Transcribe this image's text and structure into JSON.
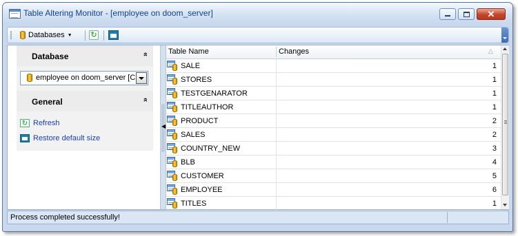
{
  "window": {
    "title": "Table Altering Monitor - [employee on doom_server]",
    "buttons": {
      "minimize": "",
      "maximize": "",
      "close": "✕"
    }
  },
  "toolbar": {
    "databases_label": "Databases",
    "refresh_glyph": "↻"
  },
  "left_panel": {
    "database": {
      "title": "Database",
      "collapse_glyph": "»",
      "selected": "employee on doom_server [C"
    },
    "general": {
      "title": "General",
      "collapse_glyph": "»",
      "links": [
        {
          "label": "Refresh",
          "icon": "refresh-icon"
        },
        {
          "label": "Restore default size",
          "icon": "restore-size-icon"
        }
      ]
    }
  },
  "splitter": {
    "arrow_glyph": "◀"
  },
  "grid": {
    "columns": [
      "Table Name",
      "Changes"
    ],
    "sort_indicator": "△",
    "rows": [
      {
        "name": "SALE",
        "changes": "1"
      },
      {
        "name": "STORES",
        "changes": "1"
      },
      {
        "name": "TESTGENARATOR",
        "changes": "1"
      },
      {
        "name": "TITLEAUTHOR",
        "changes": "1"
      },
      {
        "name": "PRODUCT",
        "changes": "2"
      },
      {
        "name": "SALES",
        "changes": "2"
      },
      {
        "name": "COUNTRY_NEW",
        "changes": "3"
      },
      {
        "name": "BLB",
        "changes": "4"
      },
      {
        "name": "CUSTOMER",
        "changes": "5"
      },
      {
        "name": "EMPLOYEE",
        "changes": "6"
      },
      {
        "name": "TITLES",
        "changes": "1"
      }
    ]
  },
  "status": {
    "message": "Process completed successfully!"
  },
  "colors": {
    "title_text": "#15428b",
    "link": "#1a3fb3",
    "frame": "#c9d8ec",
    "close_button": "#c4452a"
  }
}
